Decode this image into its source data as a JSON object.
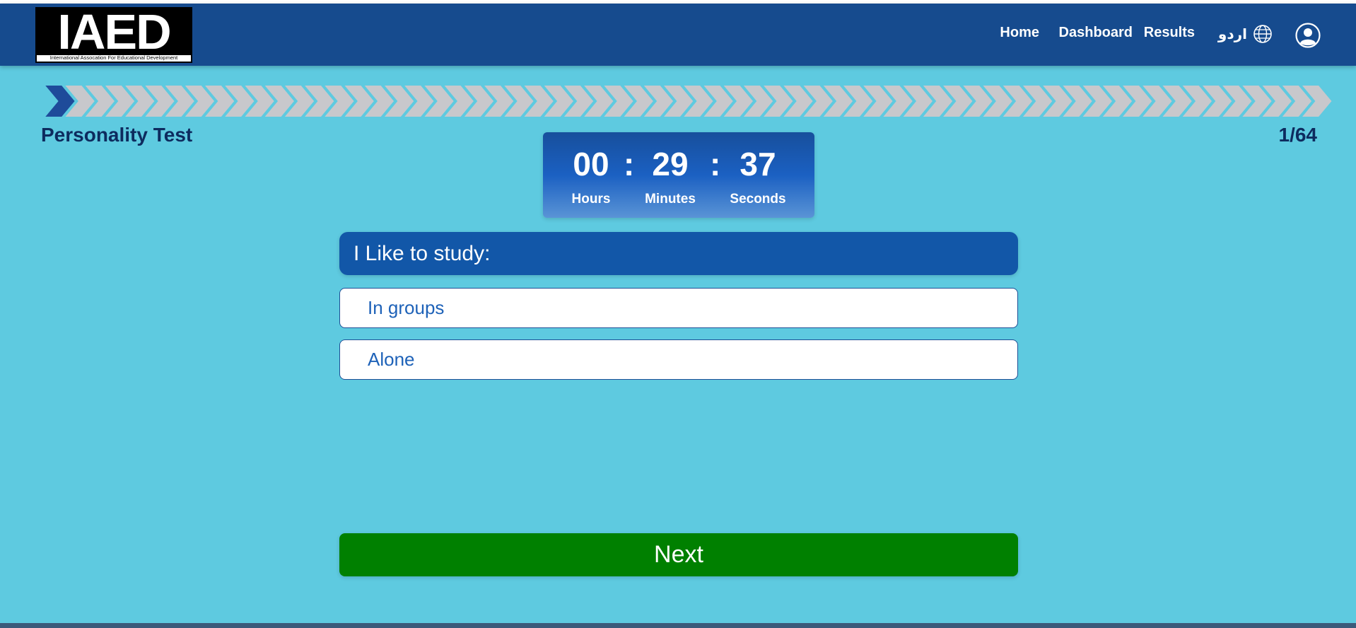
{
  "brand": {
    "logo_text": "IAED",
    "logo_subtitle": "International Assocation For Educational Development"
  },
  "nav": {
    "home": "Home",
    "dashboard": "Dashboard",
    "results": "Results",
    "language": "اردو",
    "language_icon": "globe-icon",
    "profile_icon": "user-circle-icon"
  },
  "progress": {
    "current": 1,
    "total": 64,
    "fraction": 0.015625
  },
  "test": {
    "title": "Personality Test",
    "counter": "1/64"
  },
  "timer": {
    "hours": "00",
    "minutes": "29",
    "seconds": "37",
    "separator": ":",
    "hours_label": "Hours",
    "minutes_label": "Minutes",
    "seconds_label": "Seconds"
  },
  "question": {
    "text": "I Like to study:",
    "options": [
      "In groups",
      "Alone"
    ]
  },
  "actions": {
    "next_label": "Next"
  },
  "colors": {
    "background": "#5ecae0",
    "navbar": "#164b8e",
    "question_bg": "#1257a8",
    "next_bg": "#008000",
    "progress_active": "#1e4b9a",
    "progress_inactive": "#c8c8cc"
  }
}
